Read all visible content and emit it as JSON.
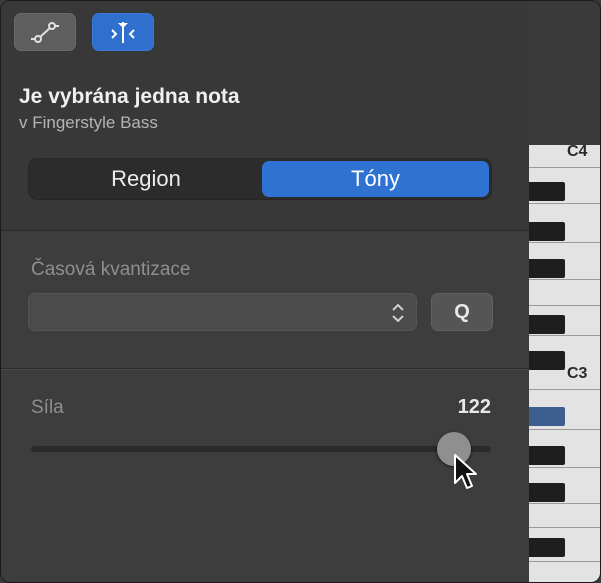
{
  "header": {
    "title": "Je vybrána jedna nota",
    "subtitle": "v Fingerstyle Bass"
  },
  "toolbar": {
    "left_icon": "automation-curve-icon",
    "right_icon": "quantize-align-icon"
  },
  "segmented": {
    "items": [
      {
        "label": "Region",
        "selected": false
      },
      {
        "label": "Tóny",
        "selected": true
      }
    ]
  },
  "quantize": {
    "label": "Časová kvantizace",
    "value": "",
    "button_label": "Q"
  },
  "velocity": {
    "label": "Síla",
    "value": "122",
    "level": 122,
    "max": 127
  },
  "piano": {
    "labels": [
      "C4",
      "C3"
    ]
  },
  "colors": {
    "accent": "#2f72d2",
    "background": "#3d3d3d",
    "selected_key": "#3d5f8f"
  }
}
